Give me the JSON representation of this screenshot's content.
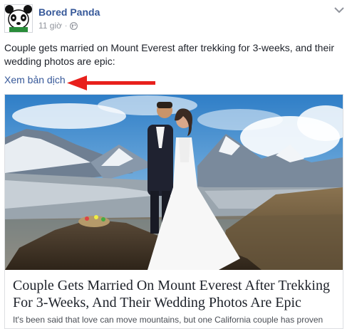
{
  "post": {
    "page_name": "Bored Panda",
    "timestamp": "11 giờ",
    "separator": "·",
    "caption": "Couple gets married on Mount Everest after trekking for 3-weeks, and their wedding photos are epic:",
    "see_translation": "Xem bản dịch"
  },
  "link_preview": {
    "title": "Couple Gets Married On Mount Everest After Trekking For 3-Weeks, And Their Wedding Photos Are Epic",
    "description": "It's been said that love can move mountains, but one California couple has proven"
  },
  "icons": {
    "avatar": "panda-logo",
    "audience": "globe-icon",
    "menu": "chevron-down-icon",
    "annotation": "red-arrow-icon"
  },
  "colors": {
    "link": "#365899",
    "text": "#1d2129",
    "meta": "#90949c",
    "arrow": "#e8201c"
  }
}
